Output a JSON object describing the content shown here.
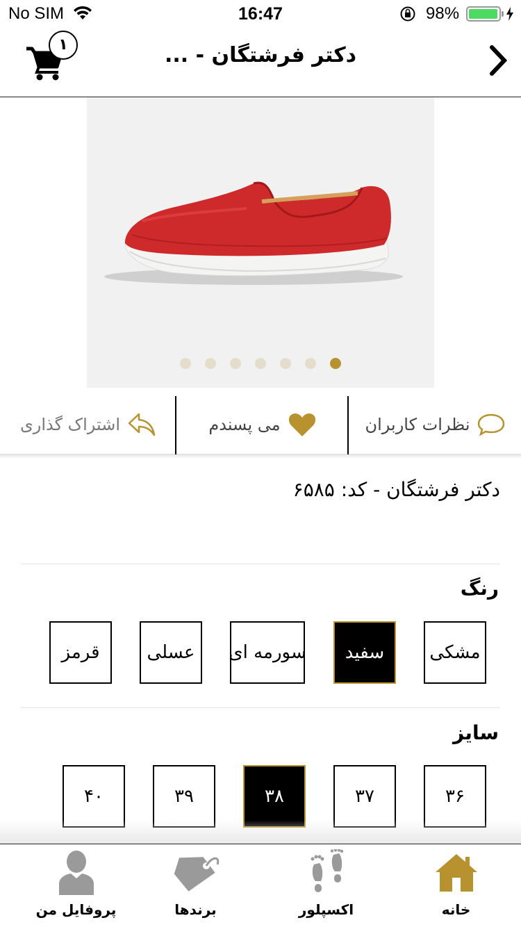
{
  "status_bar": {
    "carrier": "No SIM",
    "time": "16:47",
    "battery_percent": "98%",
    "battery_level": 0.98
  },
  "nav": {
    "title": "دکتر فرشتگان - ...",
    "cart_count": "۱"
  },
  "gallery": {
    "image": "red-slip-on-shoe",
    "dot_count": 7,
    "active_dot": 6
  },
  "actions": {
    "comments_label": "نظرات کاربران",
    "like_label": "می پسندم",
    "share_label": "اشتراک گذاری"
  },
  "product": {
    "code_text": "دکتر فرشتگان - کد: ۶۵۸۵"
  },
  "color_section": {
    "title": "رنگ",
    "options": [
      "مشکی",
      "سفید",
      "سورمه ای",
      "عسلی",
      "قرمز"
    ],
    "selected": "سفید"
  },
  "size_section": {
    "title": "سایز",
    "options": [
      "۳۶",
      "۳۷",
      "۳۸",
      "۳۹",
      "۴۰"
    ],
    "selected": "۳۸"
  },
  "tabs": [
    {
      "label": "خانه",
      "icon": "home-icon",
      "active": true
    },
    {
      "label": "اکسپلور",
      "icon": "footprints-icon",
      "active": false
    },
    {
      "label": "برندها",
      "icon": "tag-icon",
      "active": false
    },
    {
      "label": "پروفایل من",
      "icon": "user-icon",
      "active": false
    }
  ],
  "colors": {
    "accent": "#b8922f",
    "icon_gray": "#9a9a9a",
    "dot_inactive": "#e4ddcc"
  }
}
